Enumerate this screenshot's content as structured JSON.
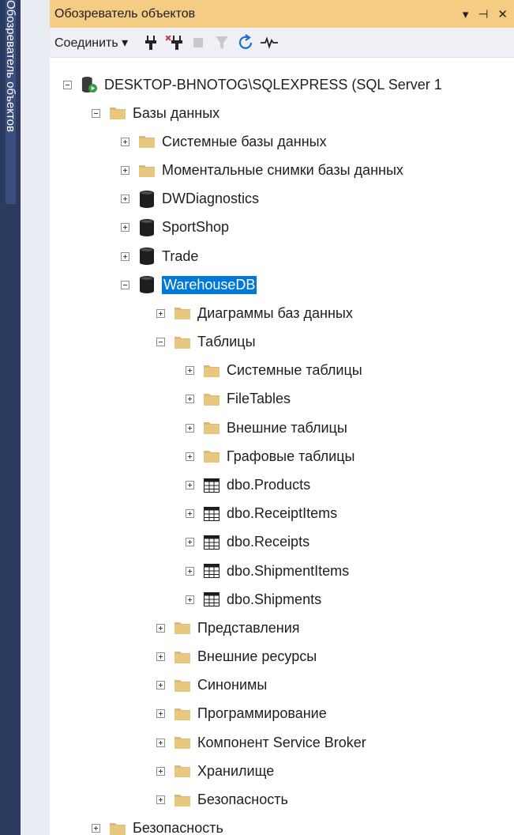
{
  "side_tab": {
    "label": "Обозреватель объектов"
  },
  "title_bar": {
    "title": "Обозреватель объектов",
    "pin_glyph": "▾ ⊣ ✕"
  },
  "toolbar": {
    "connect_label": "Соединить ▾"
  },
  "tree": [
    {
      "level": 0,
      "type": "server",
      "expander": "minus",
      "label": "DESKTOP-BHNOTOG\\SQLEXPRESS (SQL Server 1"
    },
    {
      "level": 1,
      "type": "folder",
      "expander": "minus",
      "label": "Базы данных"
    },
    {
      "level": 2,
      "type": "folder",
      "expander": "plus",
      "label": "Системные базы данных"
    },
    {
      "level": 2,
      "type": "folder",
      "expander": "plus",
      "label": "Моментальные снимки базы данных"
    },
    {
      "level": 2,
      "type": "database",
      "expander": "plus",
      "label": "DWDiagnostics"
    },
    {
      "level": 2,
      "type": "database",
      "expander": "plus",
      "label": "SportShop"
    },
    {
      "level": 2,
      "type": "database",
      "expander": "plus",
      "label": "Trade"
    },
    {
      "level": 2,
      "type": "database",
      "expander": "minus",
      "label": "WarehouseDB",
      "selected": true
    },
    {
      "level": 3,
      "type": "folder",
      "expander": "plus",
      "label": "Диаграммы баз данных"
    },
    {
      "level": 3,
      "type": "folder",
      "expander": "minus",
      "label": "Таблицы"
    },
    {
      "level": 4,
      "type": "folder",
      "expander": "plus",
      "label": "Системные таблицы"
    },
    {
      "level": 4,
      "type": "folder",
      "expander": "plus",
      "label": "FileTables"
    },
    {
      "level": 4,
      "type": "folder",
      "expander": "plus",
      "label": "Внешние таблицы"
    },
    {
      "level": 4,
      "type": "folder",
      "expander": "plus",
      "label": "Графовые таблицы"
    },
    {
      "level": 4,
      "type": "table",
      "expander": "plus",
      "label": "dbo.Products"
    },
    {
      "level": 4,
      "type": "table",
      "expander": "plus",
      "label": "dbo.ReceiptItems"
    },
    {
      "level": 4,
      "type": "table",
      "expander": "plus",
      "label": "dbo.Receipts"
    },
    {
      "level": 4,
      "type": "table",
      "expander": "plus",
      "label": "dbo.ShipmentItems"
    },
    {
      "level": 4,
      "type": "table",
      "expander": "plus",
      "label": "dbo.Shipments"
    },
    {
      "level": 3,
      "type": "folder",
      "expander": "plus",
      "label": "Представления"
    },
    {
      "level": 3,
      "type": "folder",
      "expander": "plus",
      "label": "Внешние ресурсы"
    },
    {
      "level": 3,
      "type": "folder",
      "expander": "plus",
      "label": "Синонимы"
    },
    {
      "level": 3,
      "type": "folder",
      "expander": "plus",
      "label": "Программирование"
    },
    {
      "level": 3,
      "type": "folder",
      "expander": "plus",
      "label": "Компонент Service Broker"
    },
    {
      "level": 3,
      "type": "folder",
      "expander": "plus",
      "label": "Хранилище"
    },
    {
      "level": 3,
      "type": "folder",
      "expander": "plus",
      "label": "Безопасность"
    },
    {
      "level": 1,
      "type": "folder",
      "expander": "plus",
      "label": "Безопасность"
    }
  ],
  "colors": {
    "title_bar": "#f5cc84",
    "selection": "#0078d7",
    "folder": "#dcb67a",
    "side_strip": "#2b3b60"
  }
}
